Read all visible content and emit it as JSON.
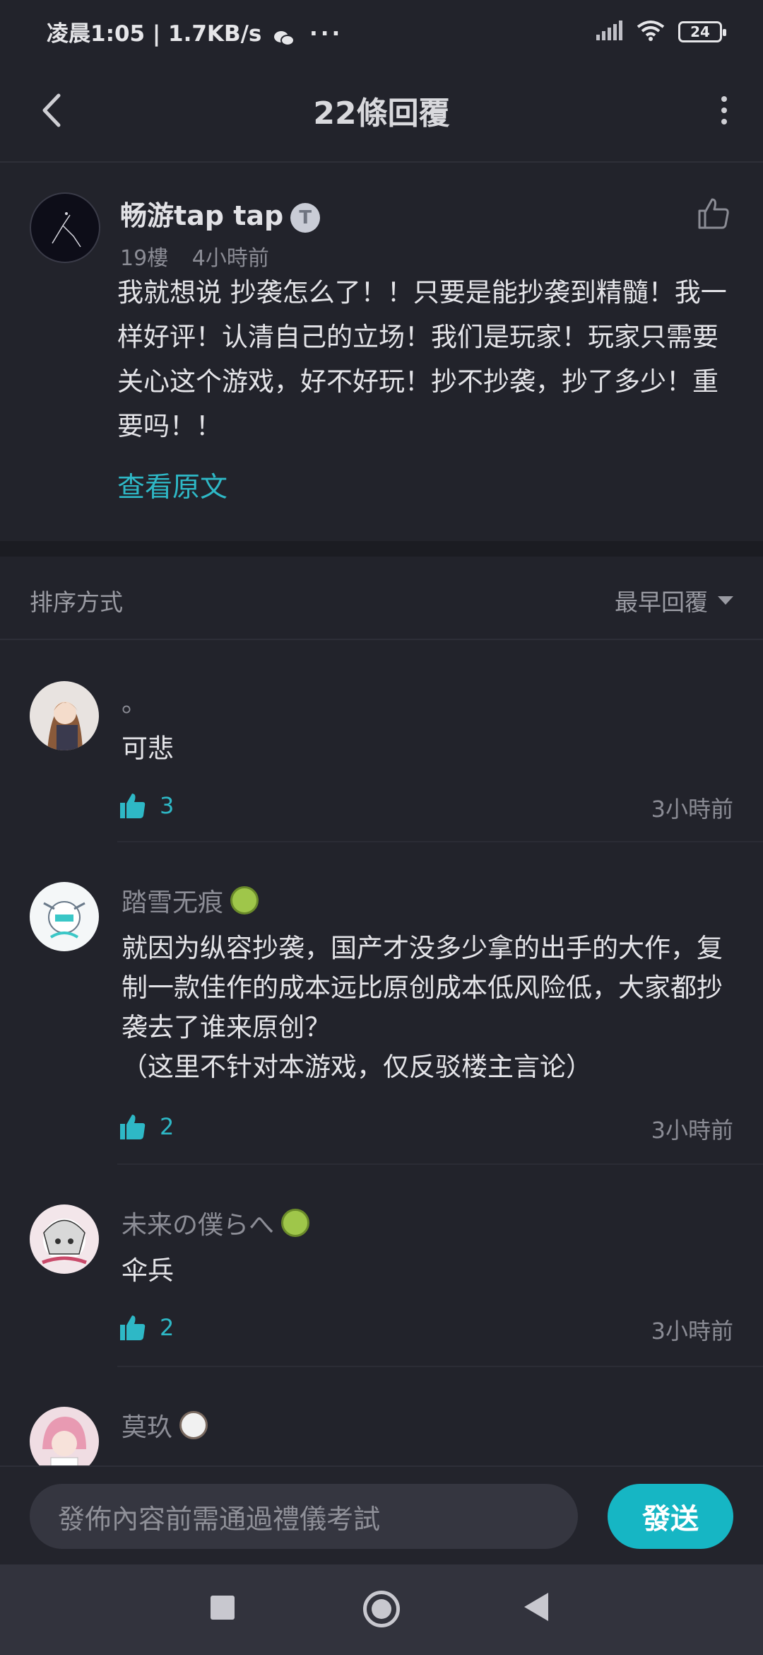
{
  "status_bar": {
    "time_text": "凌晨1:05 | 1.7KB/s",
    "battery": "24"
  },
  "header": {
    "title": "22條回覆"
  },
  "original_post": {
    "author": "畅游tap tap",
    "verify_badge": "T",
    "floor": "19樓",
    "time": "4小時前",
    "text": "我就想说  抄袭怎么了！！只要是能抄袭到精髓！我一样好评！认清自己的立场！我们是玩家！玩家只需要关心这个游戏，好不好玩！抄不抄袭，抄了多少！重要吗！！",
    "view_original": "查看原文"
  },
  "sort": {
    "label": "排序方式",
    "value": "最早回覆"
  },
  "replies": [
    {
      "name": "。",
      "badge": "",
      "text": "可悲",
      "likes": "3",
      "time": "3小時前"
    },
    {
      "name": "踏雪无痕",
      "badge": "green",
      "text": "就因为纵容抄袭，国产才没多少拿的出手的大作，复制一款佳作的成本远比原创成本低风险低，大家都抄袭去了谁来原创？\n（这里不针对本游戏，仅反驳楼主言论）",
      "likes": "2",
      "time": "3小時前"
    },
    {
      "name": "未来の僕らへ",
      "badge": "green",
      "text": "伞兵",
      "likes": "2",
      "time": "3小時前"
    },
    {
      "name": "莫玖",
      "badge": "panda",
      "text": "",
      "likes": "",
      "time": ""
    }
  ],
  "input": {
    "placeholder": "發佈內容前需通過禮儀考試",
    "send_label": "發送"
  },
  "colors": {
    "background": "#22232b",
    "accent": "#16b6c4",
    "link": "#2eb8c6"
  }
}
